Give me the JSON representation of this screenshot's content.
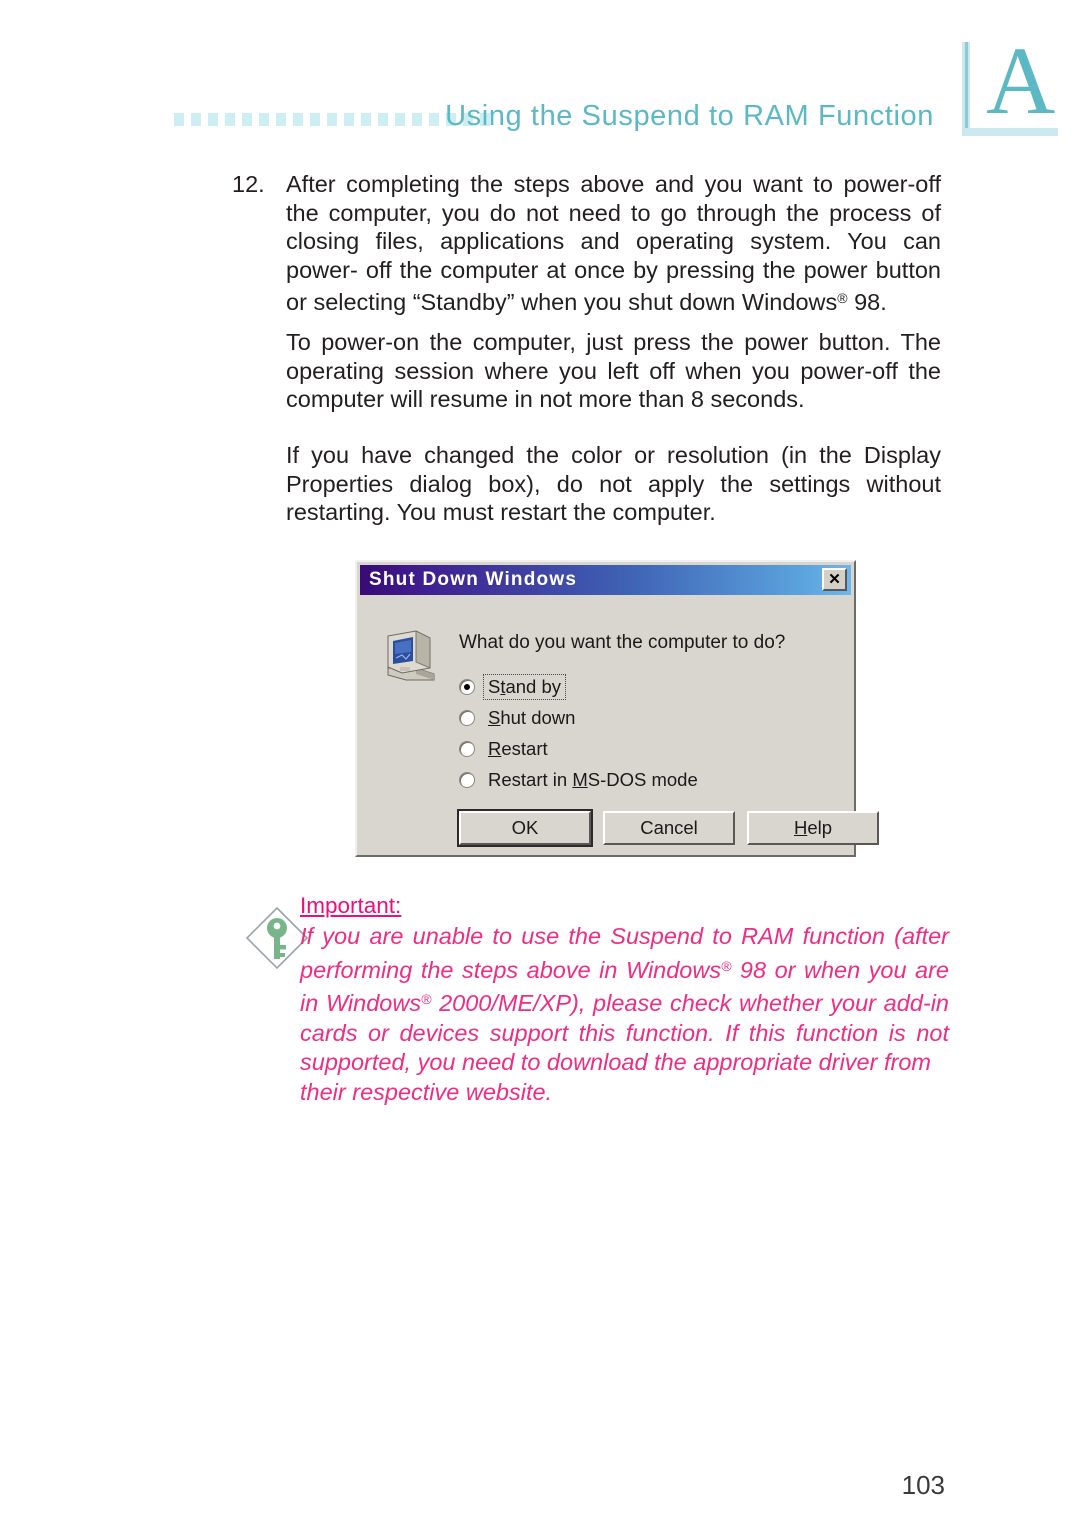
{
  "header": {
    "title": "Using the Suspend to RAM Function",
    "tab_letter": "A",
    "dot_count": 19,
    "accent_color": "#5cb9c4",
    "dot_color": "#cdeef2"
  },
  "body": {
    "item_12": {
      "number": "12.",
      "lines": [
        "After completing the steps above and you want to power-off",
        "the computer, you do not need to go through the process of",
        "closing files, applications and operating system. You can power-",
        "off the computer at once by pressing the power button or",
        "selecting “Standby” when you shut down Windows® 98."
      ],
      "text": "After completing the steps above and you want to power-off the computer, you do not need to go through the process of closing files, applications and operating system. You can power-off the computer at once by pressing the power button or selecting “Standby” when you shut down Windows® 98."
    },
    "para_power_on": {
      "lines": [
        "To power-on the computer, just press the power button. The",
        "operating session where you left off when you power-off the",
        "computer will resume in not more than 8 seconds."
      ],
      "text": "To power-on the computer, just press the power button. The operating session where you left off when you power-off the computer will resume in not more than 8 seconds."
    },
    "para_display": {
      "lines": [
        "If you have changed the color or resolution (in the Display",
        "Properties dialog box), do not apply the settings without",
        "restarting. You must restart the computer."
      ],
      "text": "If you have changed the color or resolution (in the Display Properties dialog box), do not apply the settings without restarting. You must restart the computer."
    }
  },
  "dialog": {
    "title": "Shut Down Windows",
    "close_label": "✕",
    "question": "What do you want the computer to do?",
    "icon_name": "computer-icon",
    "options": [
      {
        "label": "Stand by",
        "accel": "t",
        "selected": true,
        "focused": true
      },
      {
        "label": "Shut down",
        "accel": "S",
        "selected": false,
        "focused": false
      },
      {
        "label": "Restart",
        "accel": "R",
        "selected": false,
        "focused": false
      },
      {
        "label": "Restart in MS-DOS mode",
        "accel": "M",
        "selected": false,
        "focused": false
      }
    ],
    "buttons": [
      {
        "label": "OK",
        "default": true
      },
      {
        "label": "Cancel",
        "default": false
      },
      {
        "label": "Help",
        "default": false
      }
    ],
    "titlebar_gradient_from": "#380a74",
    "titlebar_gradient_to": "#6fb7e8",
    "face_color": "#d9d6cf"
  },
  "note": {
    "heading": "Important:",
    "icon_name": "key-diamond-icon",
    "color": "#ef2d83",
    "lines": [
      "If you are unable to use the Suspend to RAM function (after",
      "performing the steps above in Windows® 98 or when you are",
      "in Windows® 2000/ME/XP), please check whether your add-in",
      "cards or devices support this function. If this function is not",
      "supported, you need to download the appropriate driver from",
      "their respective website."
    ],
    "text": "If you are unable to use the Suspend to RAM function (after performing the steps above in Windows® 98 or when you are in Windows® 2000/ME/XP), please check whether your add-in cards or devices support this function. If this function is not supported, you need to download the appropriate driver from their respective website."
  },
  "footer": {
    "page_number": "103"
  }
}
